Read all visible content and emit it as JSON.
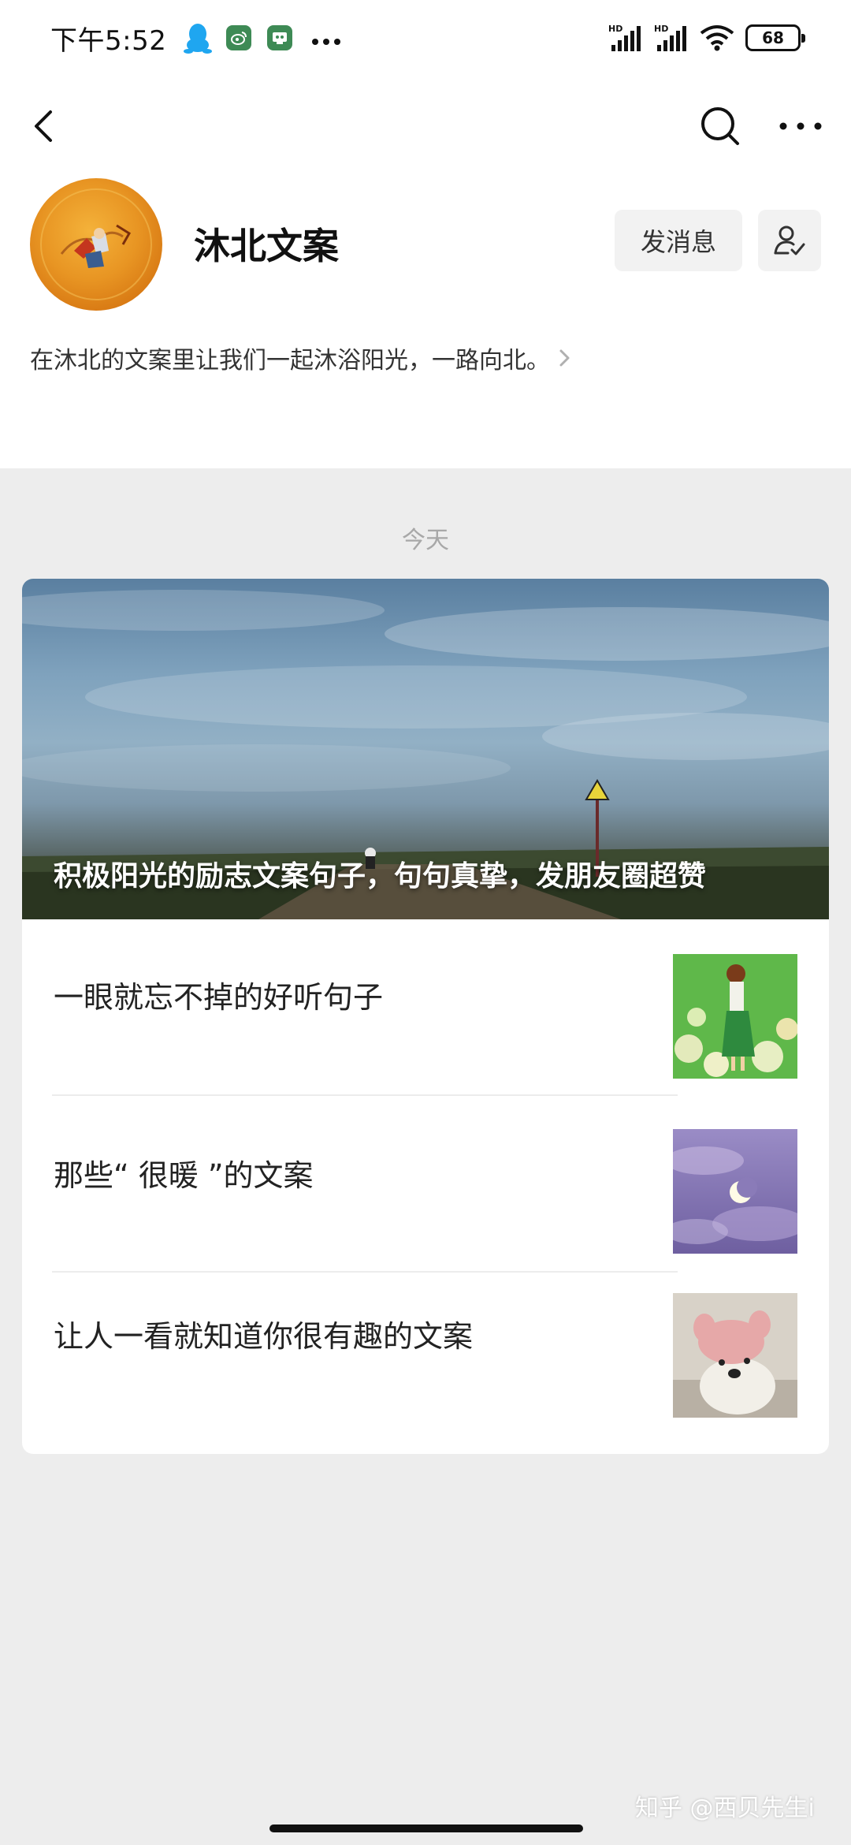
{
  "status_bar": {
    "time": "下午5:52",
    "signal_1_label": "HD",
    "signal_2_label": "HD",
    "battery": "68"
  },
  "profile": {
    "account_name": "沐北文案",
    "send_message_label": "发消息",
    "bio": "在沐北的文案里让我们一起沐浴阳光，一路向北。"
  },
  "feed": {
    "date_label": "今天",
    "cover_article_title": "积极阳光的励志文案句子，句句真挚，发朋友圈超赞",
    "articles": [
      {
        "title": "一眼就忘不掉的好听句子"
      },
      {
        "title": "那些“ 很暖 ”的文案"
      },
      {
        "title": "让人一看就知道你很有趣的文案"
      }
    ]
  },
  "watermark": "知乎 @西贝先生i",
  "colors": {
    "background": "#ededed",
    "card": "#ffffff",
    "date_text": "#a8a8a8",
    "button_bg": "#f2f2f2"
  }
}
